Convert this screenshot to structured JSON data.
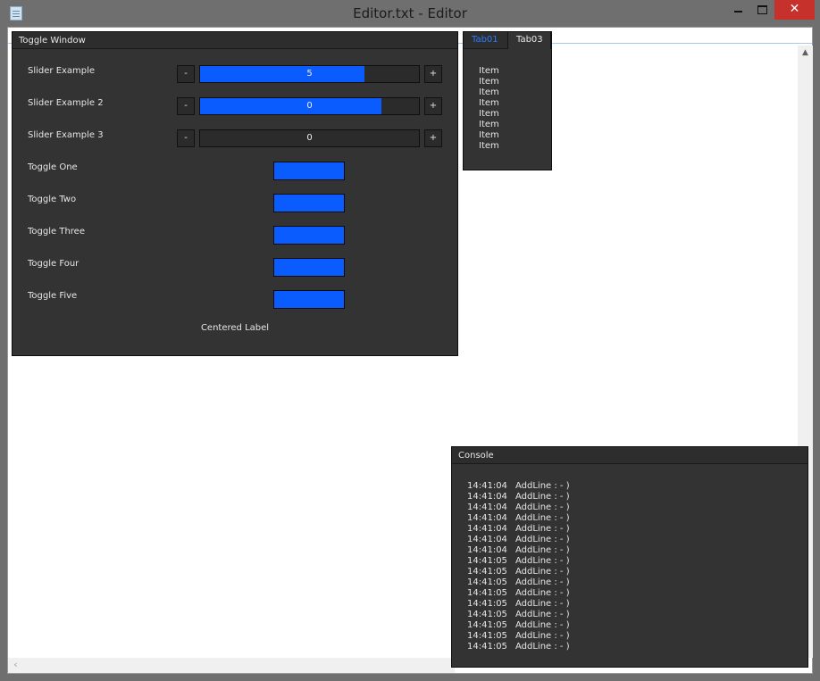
{
  "window": {
    "title": "Editor.txt - Editor",
    "icon": "notepad-icon",
    "close_glyph": "✕"
  },
  "toggle_window": {
    "title": "Toggle Window",
    "sliders": [
      {
        "label": "Slider Example",
        "minus": "-",
        "plus": "+",
        "value": "5",
        "fill_fraction": 0.75
      },
      {
        "label": "Slider Example 2",
        "minus": "-",
        "plus": "+",
        "value": "0",
        "fill_fraction": 0.83
      },
      {
        "label": "Slider Example 3",
        "minus": "-",
        "plus": "+",
        "value": "0",
        "fill_fraction": 0.0
      }
    ],
    "toggles": [
      {
        "label": "Toggle One"
      },
      {
        "label": "Toggle Two"
      },
      {
        "label": "Toggle Three"
      },
      {
        "label": "Toggle Four"
      },
      {
        "label": "Toggle Five"
      }
    ],
    "centered_label": "Centered Label"
  },
  "tab_window": {
    "tabs": [
      {
        "label": "Tab01",
        "active": true
      },
      {
        "label": "Tab03",
        "active": false
      }
    ],
    "items": [
      "Item",
      "Item",
      "Item",
      "Item",
      "Item",
      "Item",
      "Item",
      "Item"
    ]
  },
  "console": {
    "title": "Console",
    "lines": [
      {
        "time": "14:41:04",
        "text": "AddLine : - )"
      },
      {
        "time": "14:41:04",
        "text": "AddLine : - )"
      },
      {
        "time": "14:41:04",
        "text": "AddLine : - )"
      },
      {
        "time": "14:41:04",
        "text": "AddLine : - )"
      },
      {
        "time": "14:41:04",
        "text": "AddLine : - )"
      },
      {
        "time": "14:41:04",
        "text": "AddLine : - )"
      },
      {
        "time": "14:41:04",
        "text": "AddLine : - )"
      },
      {
        "time": "14:41:05",
        "text": "AddLine : - )"
      },
      {
        "time": "14:41:05",
        "text": "AddLine : - )"
      },
      {
        "time": "14:41:05",
        "text": "AddLine : - )"
      },
      {
        "time": "14:41:05",
        "text": "AddLine : - )"
      },
      {
        "time": "14:41:05",
        "text": "AddLine : - )"
      },
      {
        "time": "14:41:05",
        "text": "AddLine : - )"
      },
      {
        "time": "14:41:05",
        "text": "AddLine : - )"
      },
      {
        "time": "14:41:05",
        "text": "AddLine : - )"
      },
      {
        "time": "14:41:05",
        "text": "AddLine : - )"
      }
    ]
  },
  "colors": {
    "accent": "#0a5cff",
    "panel": "#333333",
    "close": "#c7312c"
  }
}
